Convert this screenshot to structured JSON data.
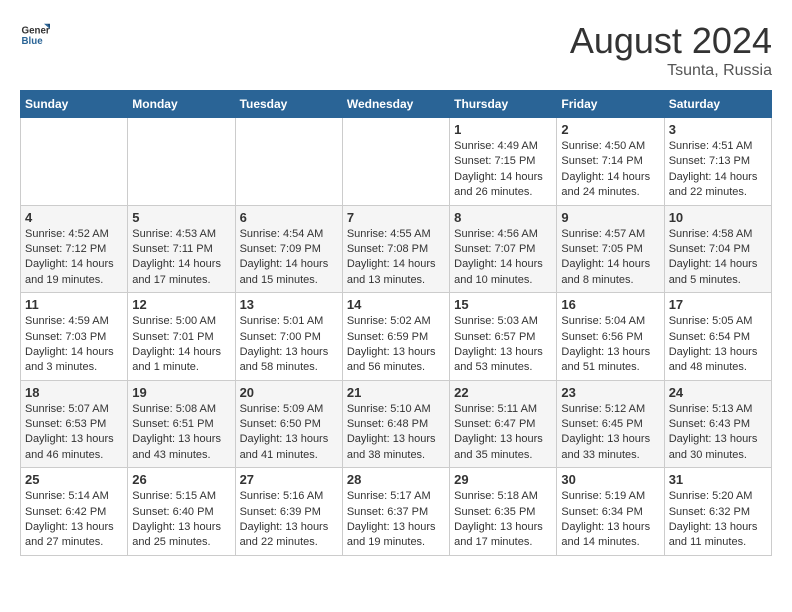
{
  "header": {
    "logo_general": "General",
    "logo_blue": "Blue",
    "month_year": "August 2024",
    "location": "Tsunta, Russia"
  },
  "weekdays": [
    "Sunday",
    "Monday",
    "Tuesday",
    "Wednesday",
    "Thursday",
    "Friday",
    "Saturday"
  ],
  "weeks": [
    [
      {
        "day": "",
        "info": ""
      },
      {
        "day": "",
        "info": ""
      },
      {
        "day": "",
        "info": ""
      },
      {
        "day": "",
        "info": ""
      },
      {
        "day": "1",
        "info": "Sunrise: 4:49 AM\nSunset: 7:15 PM\nDaylight: 14 hours\nand 26 minutes."
      },
      {
        "day": "2",
        "info": "Sunrise: 4:50 AM\nSunset: 7:14 PM\nDaylight: 14 hours\nand 24 minutes."
      },
      {
        "day": "3",
        "info": "Sunrise: 4:51 AM\nSunset: 7:13 PM\nDaylight: 14 hours\nand 22 minutes."
      }
    ],
    [
      {
        "day": "4",
        "info": "Sunrise: 4:52 AM\nSunset: 7:12 PM\nDaylight: 14 hours\nand 19 minutes."
      },
      {
        "day": "5",
        "info": "Sunrise: 4:53 AM\nSunset: 7:11 PM\nDaylight: 14 hours\nand 17 minutes."
      },
      {
        "day": "6",
        "info": "Sunrise: 4:54 AM\nSunset: 7:09 PM\nDaylight: 14 hours\nand 15 minutes."
      },
      {
        "day": "7",
        "info": "Sunrise: 4:55 AM\nSunset: 7:08 PM\nDaylight: 14 hours\nand 13 minutes."
      },
      {
        "day": "8",
        "info": "Sunrise: 4:56 AM\nSunset: 7:07 PM\nDaylight: 14 hours\nand 10 minutes."
      },
      {
        "day": "9",
        "info": "Sunrise: 4:57 AM\nSunset: 7:05 PM\nDaylight: 14 hours\nand 8 minutes."
      },
      {
        "day": "10",
        "info": "Sunrise: 4:58 AM\nSunset: 7:04 PM\nDaylight: 14 hours\nand 5 minutes."
      }
    ],
    [
      {
        "day": "11",
        "info": "Sunrise: 4:59 AM\nSunset: 7:03 PM\nDaylight: 14 hours\nand 3 minutes."
      },
      {
        "day": "12",
        "info": "Sunrise: 5:00 AM\nSunset: 7:01 PM\nDaylight: 14 hours\nand 1 minute."
      },
      {
        "day": "13",
        "info": "Sunrise: 5:01 AM\nSunset: 7:00 PM\nDaylight: 13 hours\nand 58 minutes."
      },
      {
        "day": "14",
        "info": "Sunrise: 5:02 AM\nSunset: 6:59 PM\nDaylight: 13 hours\nand 56 minutes."
      },
      {
        "day": "15",
        "info": "Sunrise: 5:03 AM\nSunset: 6:57 PM\nDaylight: 13 hours\nand 53 minutes."
      },
      {
        "day": "16",
        "info": "Sunrise: 5:04 AM\nSunset: 6:56 PM\nDaylight: 13 hours\nand 51 minutes."
      },
      {
        "day": "17",
        "info": "Sunrise: 5:05 AM\nSunset: 6:54 PM\nDaylight: 13 hours\nand 48 minutes."
      }
    ],
    [
      {
        "day": "18",
        "info": "Sunrise: 5:07 AM\nSunset: 6:53 PM\nDaylight: 13 hours\nand 46 minutes."
      },
      {
        "day": "19",
        "info": "Sunrise: 5:08 AM\nSunset: 6:51 PM\nDaylight: 13 hours\nand 43 minutes."
      },
      {
        "day": "20",
        "info": "Sunrise: 5:09 AM\nSunset: 6:50 PM\nDaylight: 13 hours\nand 41 minutes."
      },
      {
        "day": "21",
        "info": "Sunrise: 5:10 AM\nSunset: 6:48 PM\nDaylight: 13 hours\nand 38 minutes."
      },
      {
        "day": "22",
        "info": "Sunrise: 5:11 AM\nSunset: 6:47 PM\nDaylight: 13 hours\nand 35 minutes."
      },
      {
        "day": "23",
        "info": "Sunrise: 5:12 AM\nSunset: 6:45 PM\nDaylight: 13 hours\nand 33 minutes."
      },
      {
        "day": "24",
        "info": "Sunrise: 5:13 AM\nSunset: 6:43 PM\nDaylight: 13 hours\nand 30 minutes."
      }
    ],
    [
      {
        "day": "25",
        "info": "Sunrise: 5:14 AM\nSunset: 6:42 PM\nDaylight: 13 hours\nand 27 minutes."
      },
      {
        "day": "26",
        "info": "Sunrise: 5:15 AM\nSunset: 6:40 PM\nDaylight: 13 hours\nand 25 minutes."
      },
      {
        "day": "27",
        "info": "Sunrise: 5:16 AM\nSunset: 6:39 PM\nDaylight: 13 hours\nand 22 minutes."
      },
      {
        "day": "28",
        "info": "Sunrise: 5:17 AM\nSunset: 6:37 PM\nDaylight: 13 hours\nand 19 minutes."
      },
      {
        "day": "29",
        "info": "Sunrise: 5:18 AM\nSunset: 6:35 PM\nDaylight: 13 hours\nand 17 minutes."
      },
      {
        "day": "30",
        "info": "Sunrise: 5:19 AM\nSunset: 6:34 PM\nDaylight: 13 hours\nand 14 minutes."
      },
      {
        "day": "31",
        "info": "Sunrise: 5:20 AM\nSunset: 6:32 PM\nDaylight: 13 hours\nand 11 minutes."
      }
    ]
  ]
}
